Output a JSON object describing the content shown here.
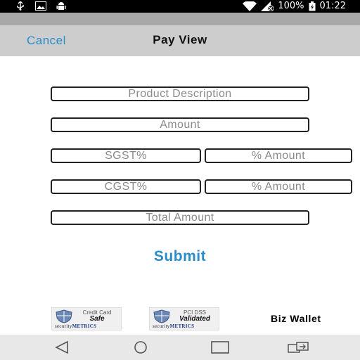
{
  "status_bar": {
    "battery": "100%",
    "time": "01:22",
    "icons_left": [
      "usb-icon",
      "image-icon",
      "android-icon"
    ],
    "icons_right": [
      "wifi-icon",
      "signal-icon",
      "battery-icon"
    ]
  },
  "nav": {
    "cancel_label": "Cancel",
    "title": "Pay View"
  },
  "form": {
    "product_description_placeholder": "Product Description",
    "amount_placeholder": "Amount",
    "sgst_placeholder": "SGST%",
    "sgst_amount_placeholder": "% Amount",
    "cgst_placeholder": "CGST%",
    "cgst_amount_placeholder": "% Amount",
    "total_amount_placeholder": "Total Amount",
    "submit_label": "Submit"
  },
  "badges": [
    {
      "line1": "Credit Card",
      "line2": "Safe",
      "brand_a": "security",
      "brand_b": "METRICS"
    },
    {
      "line1": "PCI DSS",
      "line2": "Validated",
      "brand_a": "security",
      "brand_b": "METRICS"
    }
  ],
  "brand_name": "Biz Wallet",
  "colors": {
    "accent": "#2a8cc8",
    "nav_background": "#cdcdcd",
    "status_bar": "#000000",
    "system_nav": "#e8e8e8"
  }
}
